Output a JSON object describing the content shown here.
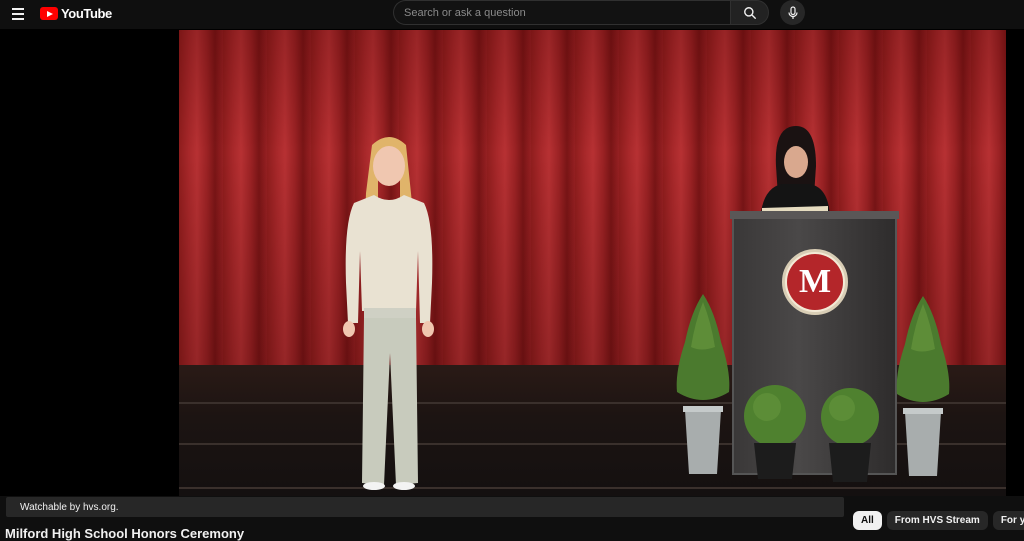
{
  "header": {
    "logo_text": "YouTube",
    "search_placeholder": "Search or ask a question",
    "icons": {
      "menu": "hamburger-icon",
      "search": "search-icon",
      "mic": "microphone-icon",
      "logo": "youtube-logo-icon"
    }
  },
  "video": {
    "podium_logo_letter": "M"
  },
  "notice": {
    "text": "Watchable by hvs.org."
  },
  "chips": [
    {
      "label": "All",
      "active": true
    },
    {
      "label": "From HVS Stream",
      "active": false
    },
    {
      "label": "For you",
      "active": false
    }
  ],
  "video_title": "Milford High School Honors Ceremony",
  "colors": {
    "brand": "#ff0000",
    "background": "#0f0f0f",
    "curtain": "#a8282a"
  }
}
